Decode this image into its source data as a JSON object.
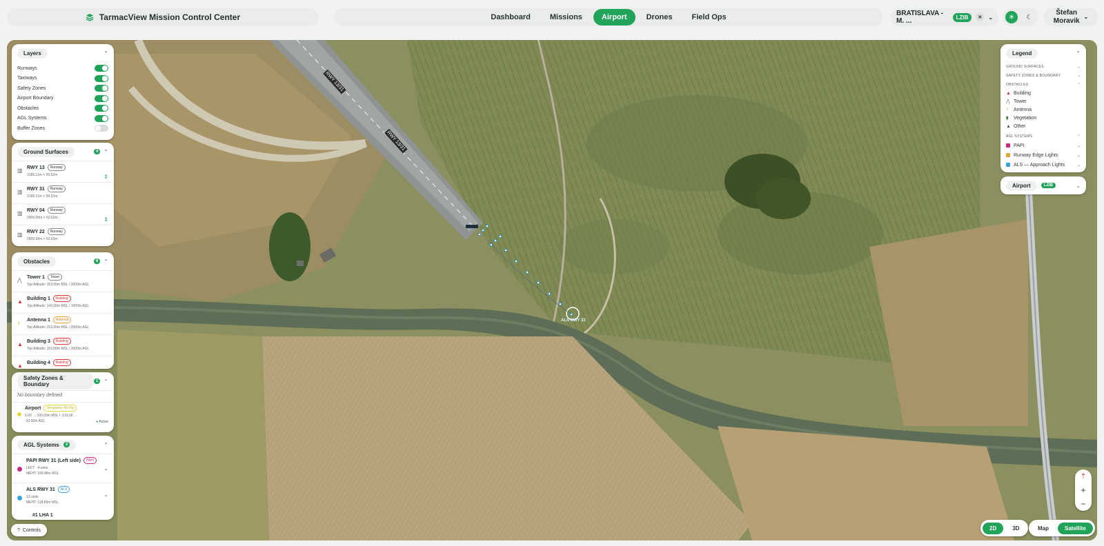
{
  "header": {
    "brand": "TarmacView Mission Control Center",
    "nav": [
      "Dashboard",
      "Missions",
      "Airport",
      "Drones",
      "Field Ops"
    ],
    "active_nav": "Airport",
    "airport_name": "BRATISLAVA - M. ...",
    "airport_code": "LZIB",
    "user_first": "Štefan",
    "user_last": "Moravik"
  },
  "layers": {
    "title": "Layers",
    "items": [
      {
        "label": "Runways",
        "on": true
      },
      {
        "label": "Taxiways",
        "on": true
      },
      {
        "label": "Safety Zones",
        "on": true
      },
      {
        "label": "Airport Boundary",
        "on": true
      },
      {
        "label": "Obstacles",
        "on": true
      },
      {
        "label": "AGL Systems",
        "on": true
      },
      {
        "label": "Buffer Zones",
        "on": false
      }
    ]
  },
  "ground": {
    "title": "Ground Surfaces",
    "count": "4",
    "items": [
      {
        "name": "RWY 13",
        "tag": "Runway",
        "dims": "3186.11m × 59.52m"
      },
      {
        "name": "RWY 31",
        "tag": "Runway",
        "dims": "3186.11m × 59.52m"
      },
      {
        "name": "RWY 04",
        "tag": "Runway",
        "dims": "2909.08m × 62.63m"
      },
      {
        "name": "RWY 22",
        "tag": "Runway",
        "dims": "2909.08m × 62.63m"
      }
    ]
  },
  "obstacles": {
    "title": "Obstacles",
    "count": "6",
    "items": [
      {
        "name": "Tower 1",
        "tag": "Tower",
        "alt": "Top Altitude: 153.00m MSL / 2000m AGL",
        "color": "#777777"
      },
      {
        "name": "Building 1",
        "tag": "Building",
        "alt": "Top Altitude: 143.00m MSL / 1000m AGL",
        "color": "#d33333"
      },
      {
        "name": "Antenna 1",
        "tag": "Antenna",
        "alt": "Top Altitude: 153.00m MSL / 2000m AGL",
        "color": "#e8a23a"
      },
      {
        "name": "Building 3",
        "tag": "Building",
        "alt": "Top Altitude: 153.00m MSL / 2000m AGL",
        "color": "#d33333"
      },
      {
        "name": "Building 4",
        "tag": "Building",
        "alt": "",
        "color": "#d33333"
      }
    ]
  },
  "safety": {
    "title": "Safety Zones & Boundary",
    "count": "1",
    "no_boundary": "No boundary defined",
    "zone_name": "Airport",
    "zone_tag": "Temporary No-Fly",
    "zone_range": "0.00 → 100.00m MSL / -133.00 → -33.00m AGL",
    "zone_status": "Active"
  },
  "agl": {
    "title": "AGL Systems",
    "count": "3",
    "items": [
      {
        "name": "PAPI RWY 31 (Left side)",
        "tag": "PAPI",
        "line1": "LEFT · 4 units",
        "line2": "MEHT: 168.88m MSL",
        "color": "#c62b87"
      },
      {
        "name": "ALS RWY 31",
        "tag": "ALS",
        "line1": "13 units",
        "line2": "MEHT: 118.89m MSL",
        "color": "#38a2e0"
      }
    ],
    "partial": "#1 LHA 1"
  },
  "controls_label": "Controls",
  "legend": {
    "title": "Legend",
    "sec_ground": "Ground Surfaces",
    "sec_safety": "Safety Zones & Boundary",
    "sec_obstacles": "Obstacles",
    "obstacles": [
      {
        "label": "Building",
        "color": "#d33333",
        "glyph": "▲"
      },
      {
        "label": "Tower",
        "color": "#777777",
        "glyph": "⋀"
      },
      {
        "label": "Antenna",
        "color": "#e8a23a",
        "glyph": "⍭"
      },
      {
        "label": "Vegetation",
        "color": "#3e7d3e",
        "glyph": "⧫"
      },
      {
        "label": "Other",
        "color": "#555555",
        "glyph": "▲"
      }
    ],
    "sec_agl": "AGL Systems",
    "agl": [
      {
        "label": "PAPI",
        "color": "#c62b87"
      },
      {
        "label": "Runway Edge Lights",
        "color": "#e8a23a"
      },
      {
        "label": "ALS — Approach Lights",
        "color": "#38a2e0"
      }
    ]
  },
  "airport_card": {
    "label": "Airport",
    "code": "LZIB"
  },
  "map_labels": {
    "rwy_label_1": "RWY 13/31",
    "rwy_label_2": "RWY 13/31",
    "als_label": "ALS RWY 31"
  },
  "view": {
    "modes": [
      "2D",
      "3D"
    ],
    "active_mode": "2D",
    "basemaps": [
      "Map",
      "Satellite"
    ],
    "active_basemap": "Satellite"
  },
  "colors": {
    "accent": "#21a35a"
  }
}
